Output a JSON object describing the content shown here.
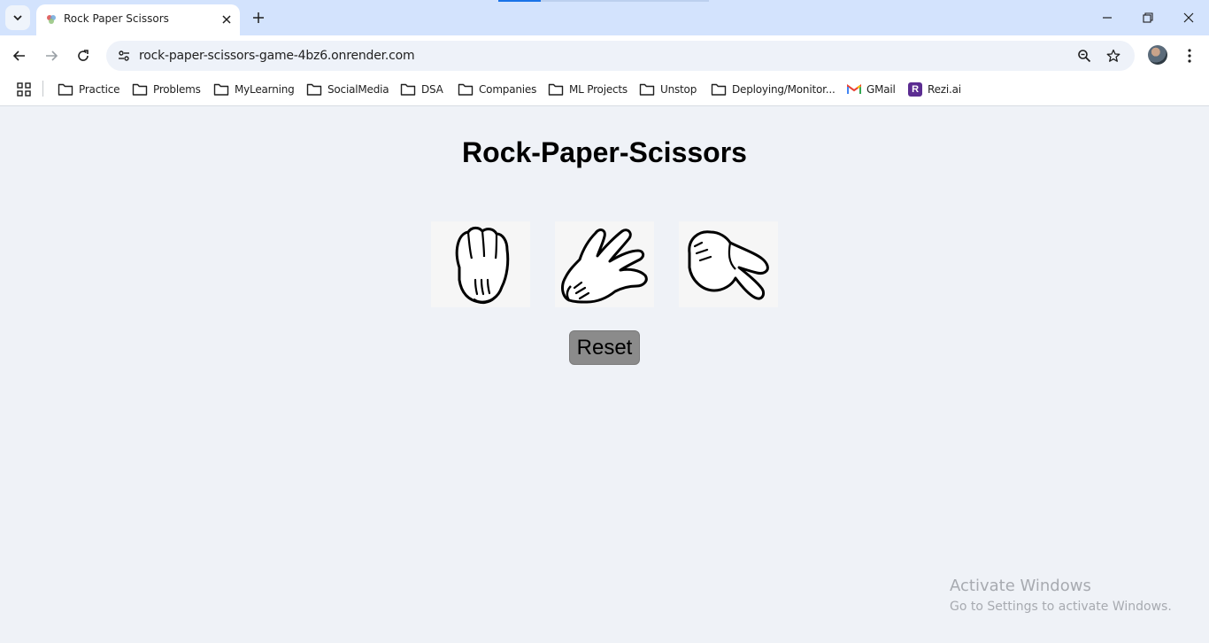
{
  "browser": {
    "tab_title": "Rock Paper Scissors",
    "url": "rock-paper-scissors-game-4bz6.onrender.com",
    "accent_color": "#d3e3fd"
  },
  "bookmarks": [
    {
      "label": "Practice",
      "icon": "folder-icon"
    },
    {
      "label": "Problems",
      "icon": "folder-icon"
    },
    {
      "label": "MyLearning",
      "icon": "folder-icon"
    },
    {
      "label": "SocialMedia",
      "icon": "folder-icon"
    },
    {
      "label": "DSA",
      "icon": "folder-icon"
    },
    {
      "label": "Companies",
      "icon": "folder-icon"
    },
    {
      "label": "ML Projects",
      "icon": "folder-icon"
    },
    {
      "label": "Unstop",
      "icon": "folder-icon"
    },
    {
      "label": "Deploying/Monitor...",
      "icon": "folder-icon"
    },
    {
      "label": "GMail",
      "icon": "gmail-icon"
    },
    {
      "label": "Rezi.ai",
      "icon": "rezi-icon",
      "icon_letter": "R"
    }
  ],
  "game": {
    "title": "Rock-Paper-Scissors",
    "choices": [
      {
        "name": "rock",
        "icon": "rock-hand-icon"
      },
      {
        "name": "paper",
        "icon": "paper-hand-icon"
      },
      {
        "name": "scissors",
        "icon": "scissors-hand-icon"
      }
    ],
    "reset_label": "Reset",
    "background_color": "#eff2f7",
    "button_color": "#8b8b8b"
  },
  "watermark": {
    "title": "Activate Windows",
    "subtitle": "Go to Settings to activate Windows."
  }
}
